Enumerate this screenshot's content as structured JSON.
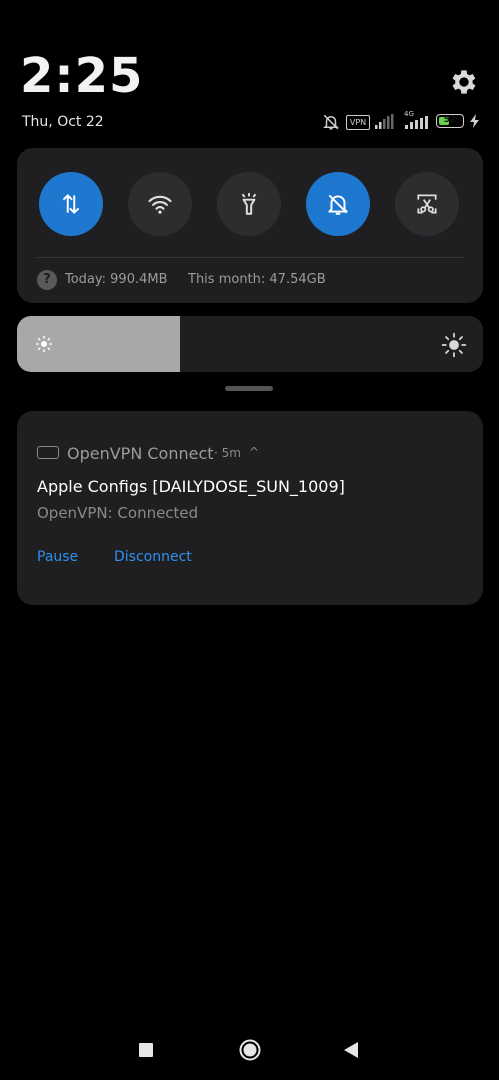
{
  "status_bar": {
    "time": "2:25",
    "date": "Thu, Oct 22",
    "vpn_badge": "VPN",
    "network": "4G",
    "battery": "52",
    "battery_level": 0.52
  },
  "quick_settings": {
    "tiles": [
      {
        "name": "mobile-data",
        "state": "on"
      },
      {
        "name": "wifi",
        "state": "off"
      },
      {
        "name": "flashlight",
        "state": "off"
      },
      {
        "name": "silent",
        "state": "on"
      },
      {
        "name": "screenshot",
        "state": "off"
      }
    ],
    "usage_today": "Today: 990.4MB",
    "usage_month": "This month: 47.54GB",
    "accent_color": "#1e78d0"
  },
  "brightness": {
    "level": 0.35
  },
  "notification": {
    "app_name": "OpenVPN Connect",
    "time": "· 5m",
    "chevron": "^",
    "title": "Apple Configs [DAILYDOSE_SUN_1009]",
    "text": "OpenVPN: Connected",
    "actions": [
      "Pause",
      "Disconnect"
    ],
    "action_color": "#2f8ff0"
  },
  "nav_bar": {
    "icons": [
      "recents-icon",
      "home-icon",
      "back-icon"
    ]
  }
}
